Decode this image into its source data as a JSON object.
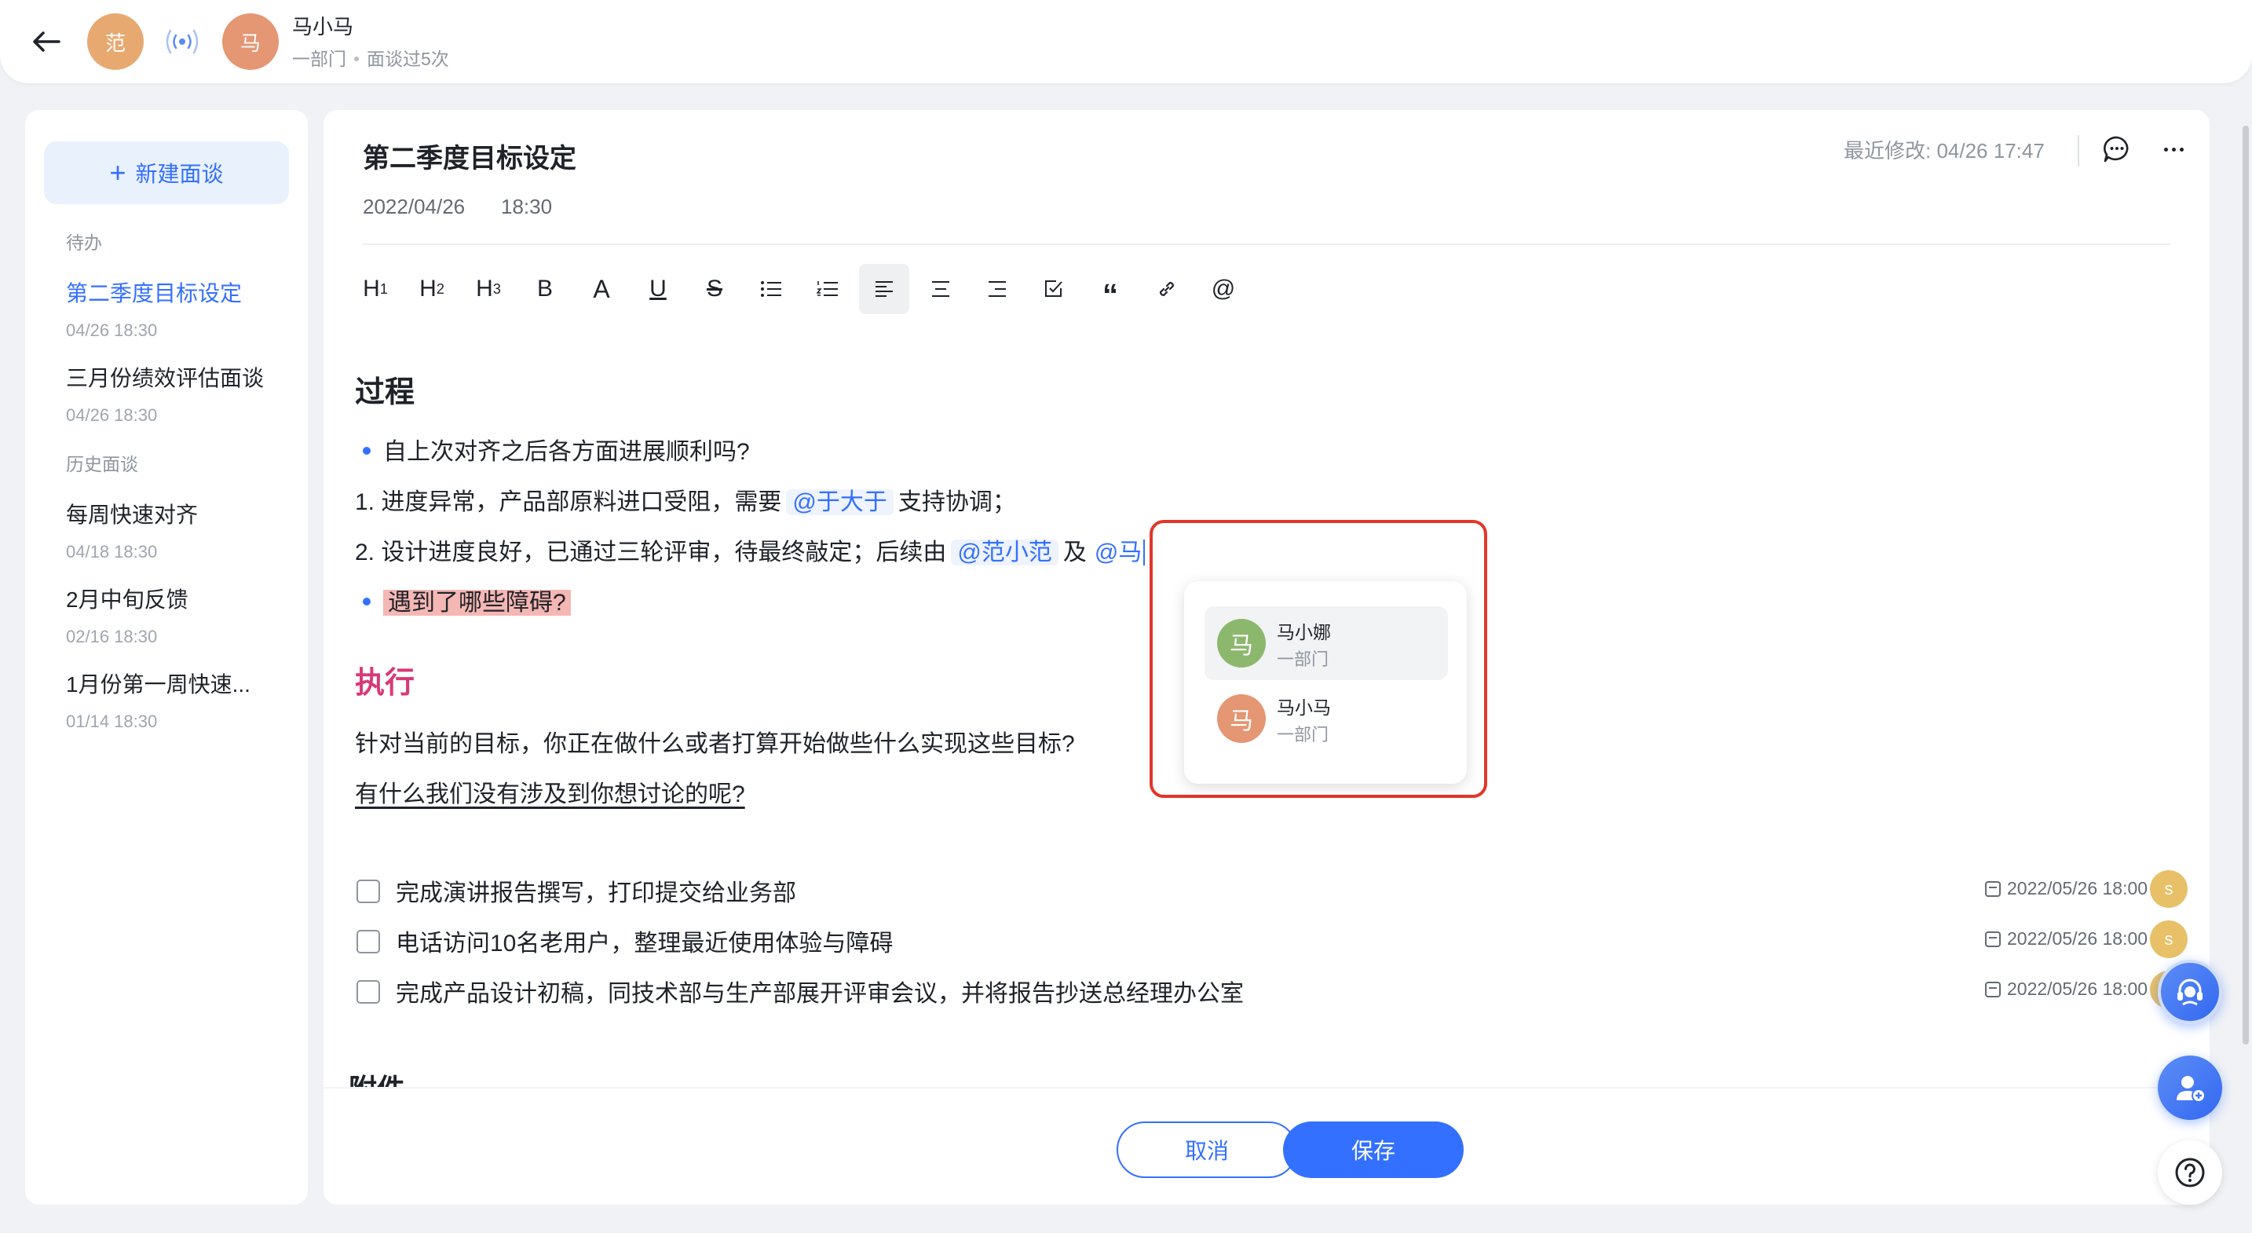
{
  "header": {
    "back_icon": "arrow-left-icon",
    "avatar_left": "范",
    "avatar_right": "马",
    "name": "马小马",
    "dept": "一部门",
    "meet_count": "面谈过5次",
    "signal_icon": "broadcast-icon",
    "avatar_left_color": "#e8a971",
    "avatar_right_color": "#e59673"
  },
  "sidebar": {
    "new_button": "新建面谈",
    "section_todo": "待办",
    "section_history": "历史面谈",
    "todo_items": [
      {
        "title": "第二季度目标设定",
        "date": "04/26 18:30"
      },
      {
        "title": "三月份绩效评估面谈",
        "date": "04/26 18:30"
      }
    ],
    "history_items": [
      {
        "title": "每周快速对齐",
        "date": "04/18 18:30"
      },
      {
        "title": "2月中旬反馈",
        "date": "02/16 18:30"
      },
      {
        "title": "1月份第一周快速...",
        "date": "01/14 18:30"
      }
    ]
  },
  "doc": {
    "title": "第二季度目标设定",
    "date": "2022/04/26",
    "time": "18:30",
    "last_modified": "最近修改: 04/26 17:47",
    "toolbar": [
      "H1",
      "H2",
      "H3",
      "B",
      "A",
      "U",
      "S",
      "bullet-list",
      "ordered-list",
      "align-left",
      "align-center",
      "align-right",
      "checkbox",
      "quote",
      "link",
      "@"
    ],
    "section_process": "过程",
    "bullet1": "自上次对齐之后各方面进展顺利吗?",
    "line1_prefix": "1. 进度异常，产品部原料进口受阻，需要",
    "line1_mention": "@于大于",
    "line1_suffix": "支持协调；",
    "line2_prefix": "2. 设计进度良好，已通过三轮评审，待最终敲定；后续由",
    "line2_mention": "@范小范",
    "line2_and": "及",
    "line2_typing": "@马",
    "bullet2": "遇到了哪些障碍?",
    "section_exec": "执行",
    "exec_line1": "针对当前的目标，你正在做什么或者打算开始做些什么实现这些目标?",
    "exec_line2": "有什么我们没有涉及到你想讨论的呢?",
    "tasks": [
      {
        "text": "完成演讲报告撰写，打印提交给业务部",
        "due": "2022/05/26 18:00",
        "assignee": "s"
      },
      {
        "text": "电话访问10名老用户，整理最近使用体验与障碍",
        "due": "2022/05/26 18:00",
        "assignee": "s"
      },
      {
        "text": "完成产品设计初稿，同技术部与生产部展开评审会议，并将报告抄送总经理办公室",
        "due": "2022/05/26 18:00",
        "assignee": "s"
      }
    ],
    "section_attach": "附件"
  },
  "mention_dropdown": {
    "options": [
      {
        "avatar": "马",
        "name": "马小娜",
        "dept": "一部门",
        "color": "#8cb86e"
      },
      {
        "avatar": "马",
        "name": "马小马",
        "dept": "一部门",
        "color": "#e59673"
      }
    ]
  },
  "footer": {
    "cancel": "取消",
    "save": "保存"
  },
  "colors": {
    "accent": "#3370ff",
    "exec_heading": "#d83978",
    "highlight": "#f5b7b4",
    "callout_border": "#e0372a"
  }
}
